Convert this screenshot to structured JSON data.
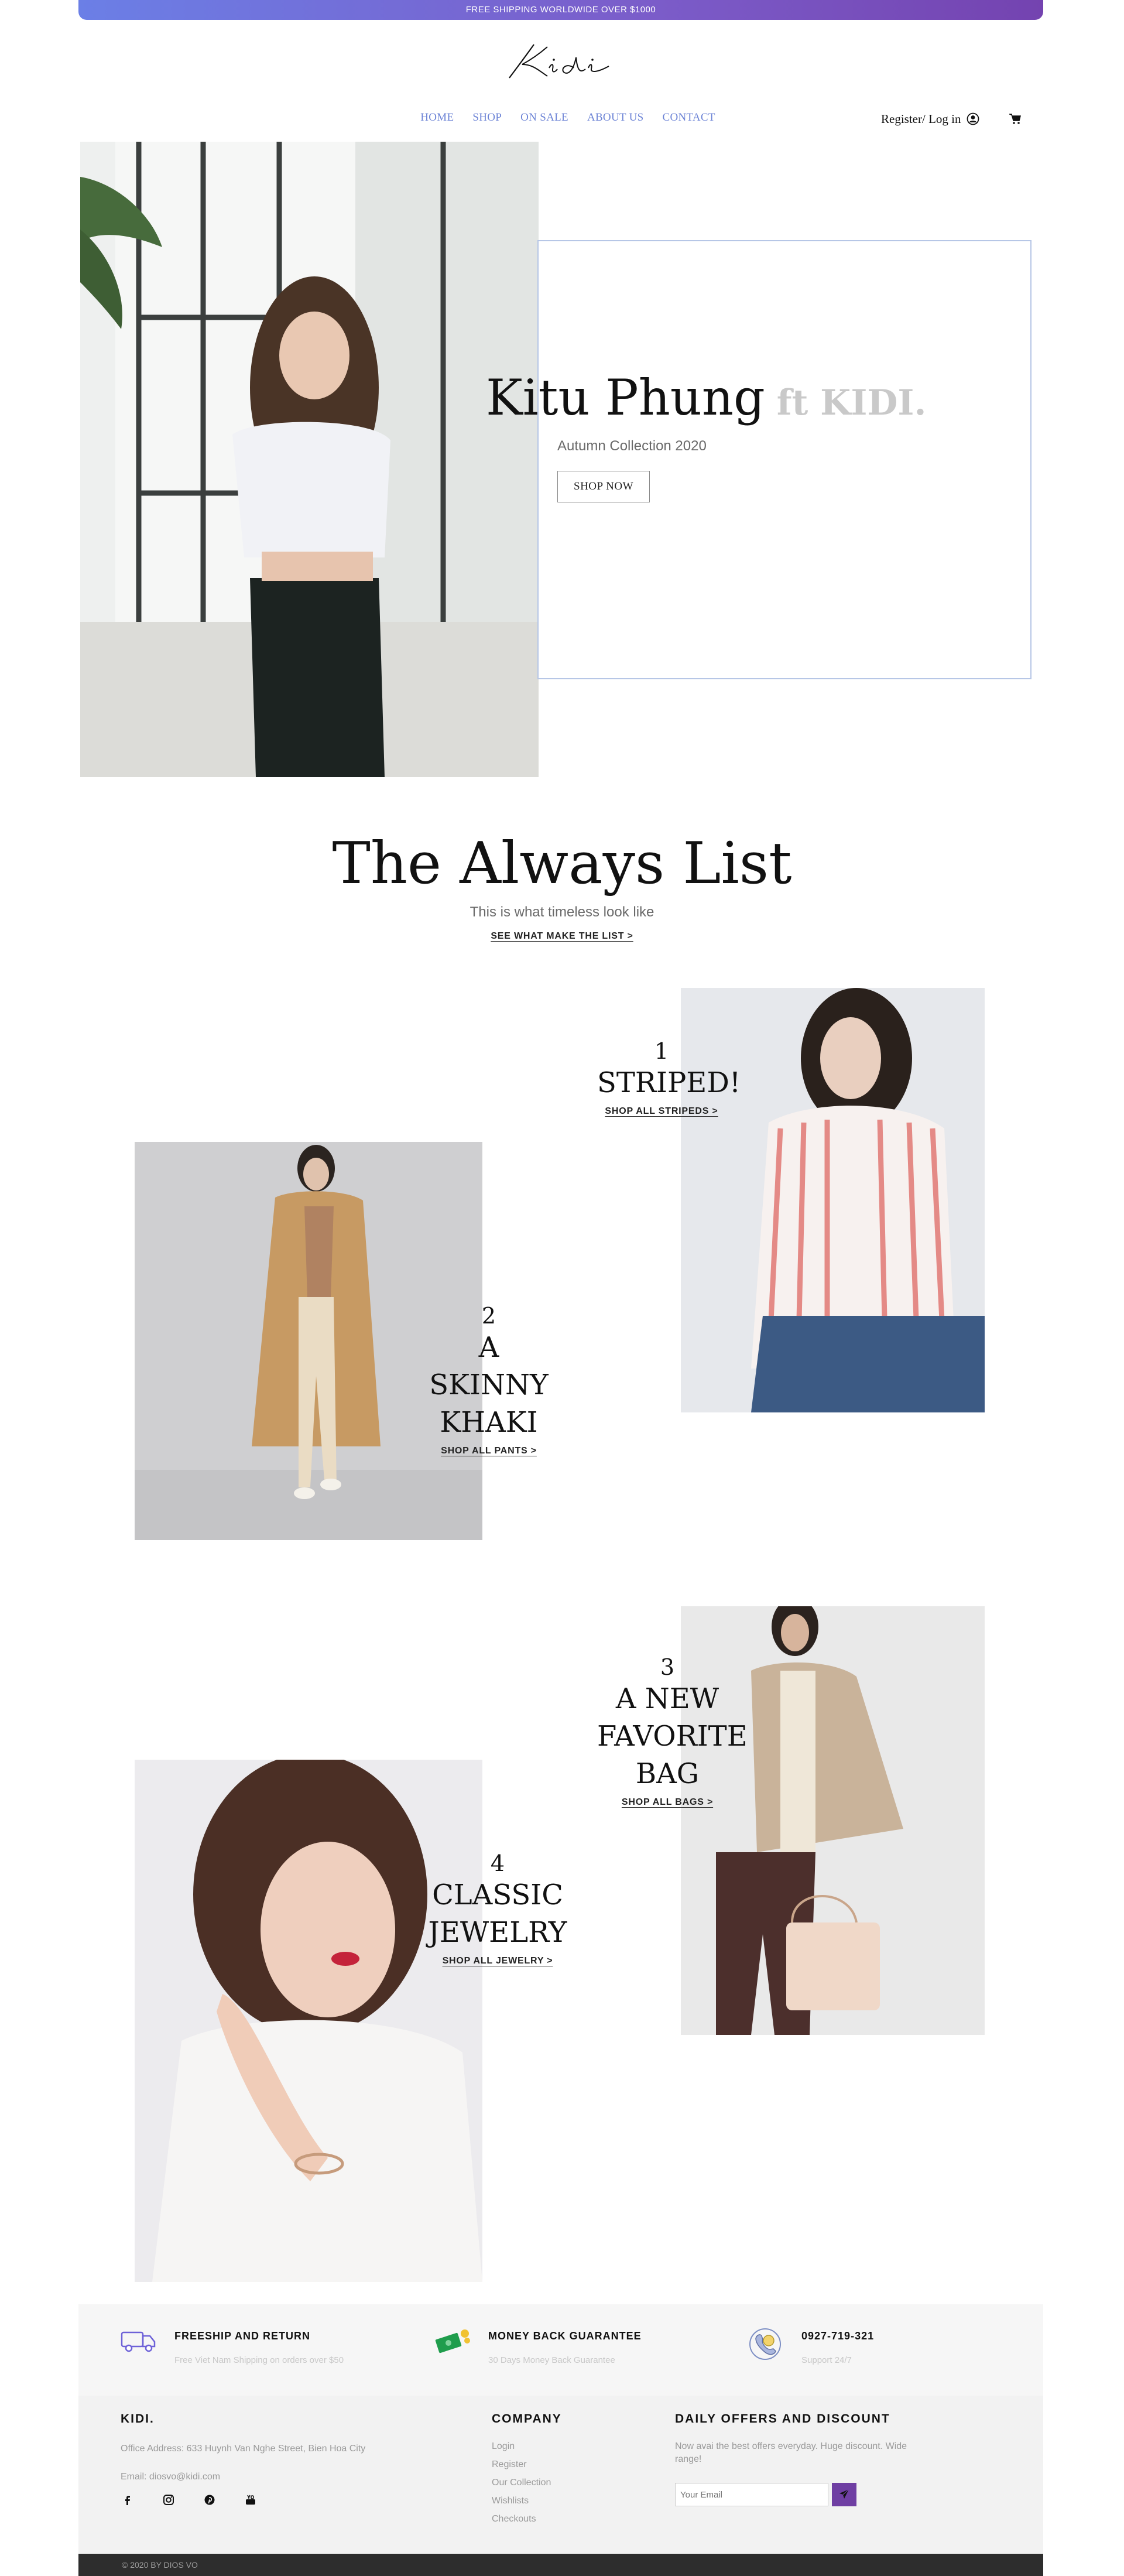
{
  "topbar": {
    "text": "FREE SHIPPING WORLDWIDE OVER $1000"
  },
  "logo": {
    "text": "Kidi"
  },
  "nav": {
    "items": [
      "HOME",
      "SHOP",
      "ON SALE",
      "ABOUT US",
      "CONTACT"
    ]
  },
  "account": {
    "label": "Register/ Log in"
  },
  "hero": {
    "name": "Kitu Phung",
    "ft": "ft KIDI.",
    "subtitle": "Autumn Collection 2020",
    "button": "SHOP NOW"
  },
  "always_list": {
    "title": "The Always List",
    "subtitle": "This is what timeless look like",
    "link": "SEE WHAT MAKE THE LIST >"
  },
  "items": [
    {
      "num": "1",
      "name": [
        "STRIPED!"
      ],
      "link": "SHOP ALL STRIPEDS >"
    },
    {
      "num": "2",
      "name": [
        "A SKINNY",
        "KHAKI"
      ],
      "link": "SHOP ALL PANTS >"
    },
    {
      "num": "3",
      "name": [
        "A NEW",
        "FAVORITE",
        "BAG"
      ],
      "link": "SHOP ALL BAGS >"
    },
    {
      "num": "4",
      "name": [
        "CLASSIC",
        "JEWELRY"
      ],
      "link": "SHOP ALL JEWELRY >"
    }
  ],
  "features": [
    {
      "icon": "truck-icon",
      "title": "FREESHIP AND RETURN",
      "sub": "Free Viet Nam Shipping on orders over $50"
    },
    {
      "icon": "money-icon",
      "title": "MONEY BACK GUARANTEE",
      "sub": "30 Days Money Back Guarantee"
    },
    {
      "icon": "phone-icon",
      "title": "0927-719-321",
      "sub": "Support 24/7"
    }
  ],
  "footer": {
    "brand": "KIDI.",
    "address": "Office Address: 633 Huynh Van Nghe Street, Bien Hoa City",
    "email": "Email: diosvo@kidi.com",
    "company_head": "COMPANY",
    "company_links": [
      "Login",
      "Register",
      "Our Collection",
      "Wishlists",
      "Checkouts"
    ],
    "offers_head": "DAILY OFFERS AND DISCOUNT",
    "offers_text_1": "Now avai the best offers everyday. Huge discount. Wide",
    "offers_text_2": "range!",
    "email_placeholder": "Your Email"
  },
  "copyright": "© 2020 BY DIOS VO",
  "colors": {
    "accent": "#6d84d6",
    "purple": "#6f3fa3",
    "frame": "#b6c6e6"
  }
}
